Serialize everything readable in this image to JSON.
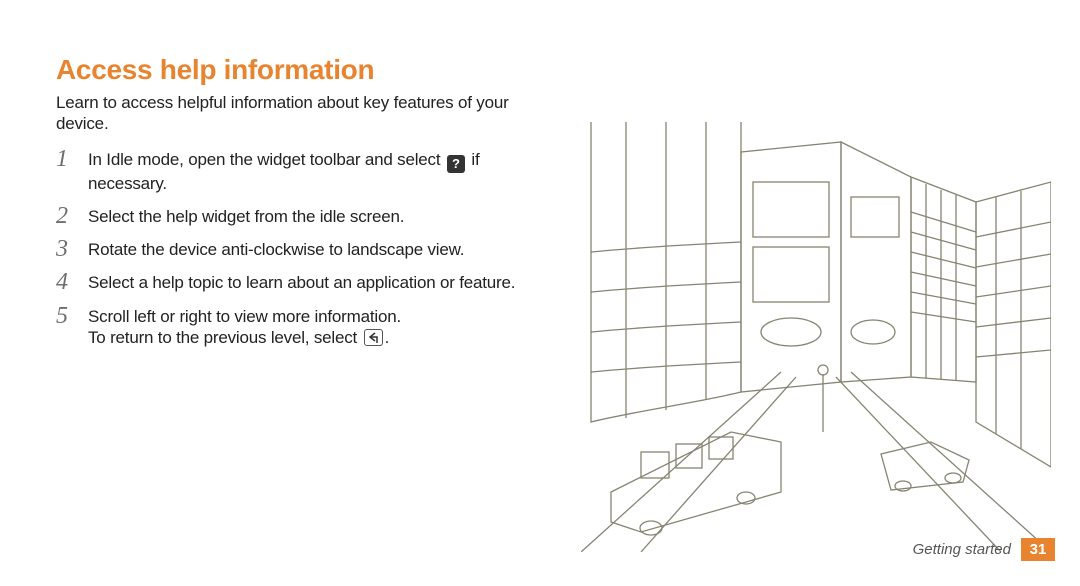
{
  "title": "Access help information",
  "intro": "Learn to access helpful information about key features of your device.",
  "steps": [
    {
      "pre": "In Idle mode, open the widget toolbar and select ",
      "icon": "help-icon",
      "post": " if necessary."
    },
    {
      "pre": "Select the help widget from the idle screen."
    },
    {
      "pre": "Rotate the device anti-clockwise to landscape view."
    },
    {
      "pre": "Select a help topic to learn about an application or feature."
    },
    {
      "pre": "Scroll left or right to view more information.",
      "line2_pre": "To return to the previous level, select ",
      "line2_icon": "back-icon",
      "line2_post": "."
    }
  ],
  "icons": {
    "help-icon": "?",
    "back-icon": "back"
  },
  "footer": {
    "section": "Getting started",
    "page": "31"
  }
}
